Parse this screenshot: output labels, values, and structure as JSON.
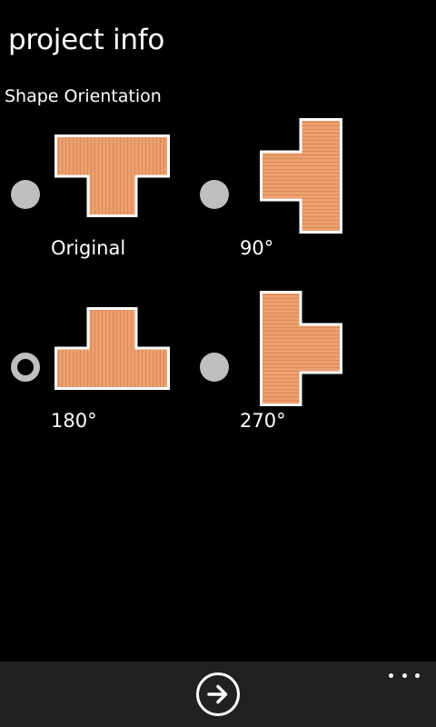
{
  "header": {
    "title": "project info"
  },
  "section": {
    "label": "Shape Orientation"
  },
  "options": [
    {
      "label": "Original",
      "selected": false
    },
    {
      "label": "90°",
      "selected": false
    },
    {
      "label": "180°",
      "selected": true
    },
    {
      "label": "270°",
      "selected": false
    }
  ],
  "colors": {
    "shape_fill": "#eda06f",
    "shape_stripe": "#d78a58",
    "shape_border": "#ffffff",
    "radio": "#bfbfbf",
    "app_bar": "#212121",
    "background": "#000000"
  },
  "app_bar": {
    "next_icon": "arrow-right-circle-icon",
    "more_icon": "ellipsis-icon"
  }
}
